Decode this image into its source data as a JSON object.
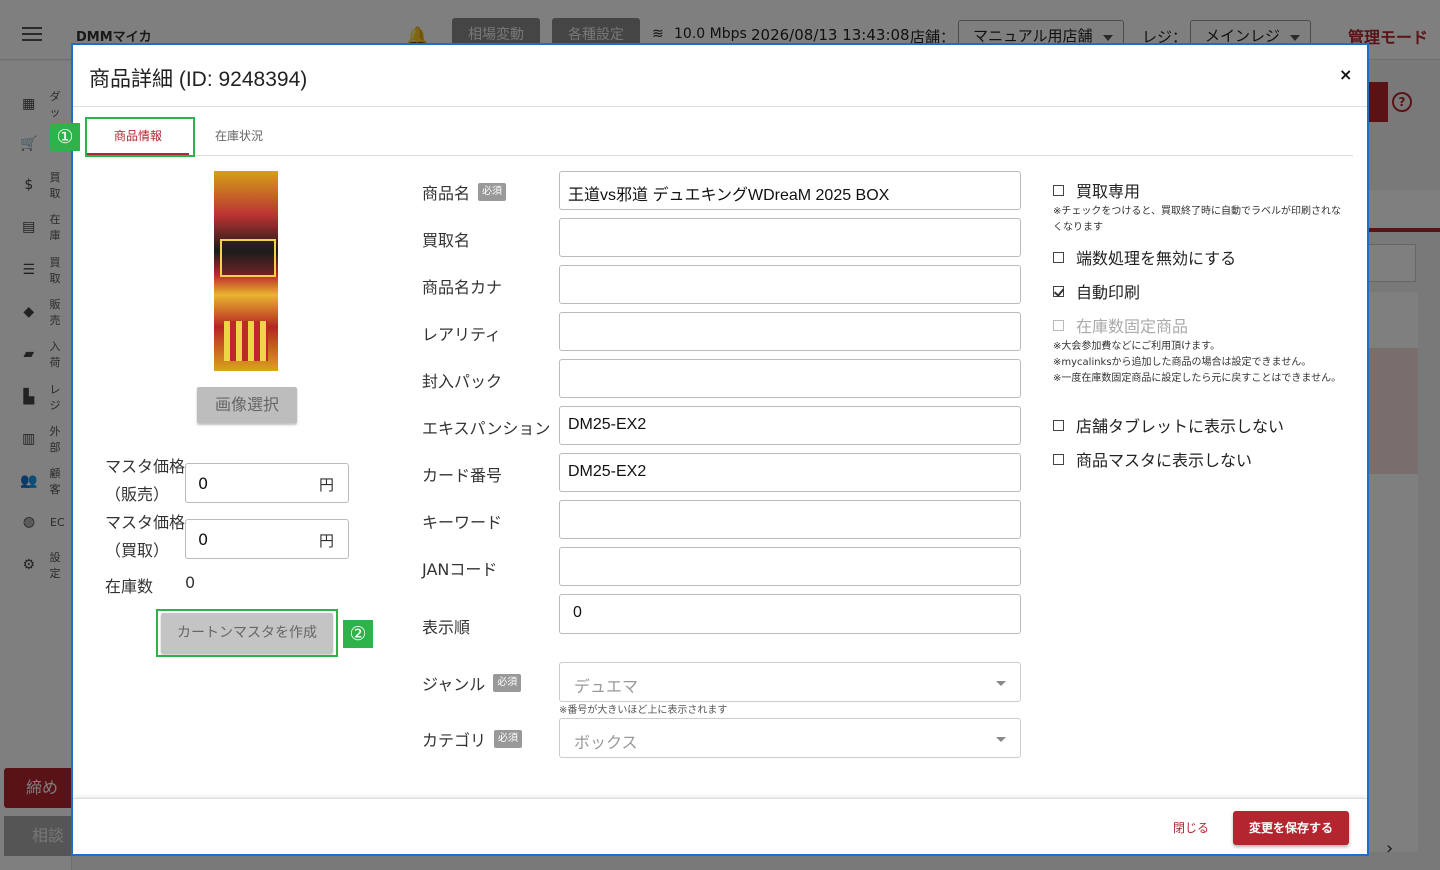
{
  "app": {
    "logo_text": "DMMマイカ",
    "top_buttons": {
      "market": "相場変動",
      "settings": "各種設定"
    },
    "network_speed": "10.0 Mbps",
    "datetime": "2026/08/13 13:43:08",
    "store_label": "店舗：",
    "store_value": "マニュアル用店舗",
    "register_label": "レジ：",
    "register_value": "メインレジ",
    "mode_label": "管理モード",
    "sidebar": {
      "items": [
        {
          "icon": "dashboard-icon",
          "label": "ダッ"
        },
        {
          "icon": "cart-icon",
          "label": ""
        },
        {
          "icon": "dollar-icon",
          "label": "買取"
        },
        {
          "icon": "archive-icon",
          "label": "在庫"
        },
        {
          "icon": "list-icon",
          "label": "買取"
        },
        {
          "icon": "tag-icon",
          "label": "販売"
        },
        {
          "icon": "truck-icon",
          "label": "入荷"
        },
        {
          "icon": "register-icon",
          "label": "レジ"
        },
        {
          "icon": "store-icon",
          "label": "外部"
        },
        {
          "icon": "people-icon",
          "label": "顧客"
        },
        {
          "icon": "globe-icon",
          "label": "EC"
        },
        {
          "icon": "gear-icon",
          "label": "設定"
        }
      ],
      "close_label": "締め",
      "consult_label": "相談"
    }
  },
  "modal": {
    "title": "商品詳細 (ID: 9248394)",
    "close_icon": "×",
    "tabs": [
      {
        "label": "商品情報",
        "active": true
      },
      {
        "label": "在庫状況",
        "active": false
      }
    ],
    "markers": {
      "one": "①",
      "two": "②"
    },
    "image_select_label": "画像選択",
    "prices": {
      "sell_label_line1": "マスタ価格",
      "sell_label_line2": "（販売）",
      "sell_value": "0",
      "buy_label_line1": "マスタ価格",
      "buy_label_line2": "（買取）",
      "buy_value": "0",
      "unit": "円",
      "stock_label": "在庫数",
      "stock_value": "0"
    },
    "carton_button_label": "カートンマスタを作成",
    "required_badge": "必須",
    "fields": {
      "product_name": {
        "label": "商品名",
        "value": "王道vs邪道 デュエキングWDreaM 2025 BOX"
      },
      "buy_name": {
        "label": "買取名",
        "value": ""
      },
      "name_kana": {
        "label": "商品名カナ",
        "value": ""
      },
      "rarity": {
        "label": "レアリティ",
        "value": ""
      },
      "pack": {
        "label": "封入パック",
        "value": ""
      },
      "expansion": {
        "label": "エキスパンション",
        "value": "DM25-EX2"
      },
      "card_number": {
        "label": "カード番号",
        "value": "DM25-EX2"
      },
      "keyword": {
        "label": "キーワード",
        "value": ""
      },
      "jan": {
        "label": "JANコード",
        "value": ""
      },
      "display_order": {
        "label": "表示順",
        "value": "0",
        "hint": "※番号が大きいほど上に表示されます"
      },
      "genre": {
        "label": "ジャンル",
        "value": "デュエマ"
      },
      "category": {
        "label": "カテゴリ",
        "value": "ボックス"
      }
    },
    "options": {
      "buy_only": {
        "label": "買取専用",
        "checked": false,
        "note": "※チェックをつけると、買取終了時に自動でラベルが印刷されなくなります"
      },
      "disable_rounding": {
        "label": "端数処理を無効にする",
        "checked": false
      },
      "auto_print": {
        "label": "自動印刷",
        "checked": true
      },
      "fixed_stock": {
        "label": "在庫数固定商品",
        "checked": false,
        "disabled": true,
        "note_lines": [
          "※大会参加費などにご利用頂けます。",
          "※mycalinksから追加した商品の場合は設定できません。",
          "※一度在庫数固定商品に設定したら元に戻すことはできません。"
        ]
      },
      "hide_tablet": {
        "label": "店舗タブレットに表示しない",
        "checked": false
      },
      "hide_master": {
        "label": "商品マスタに表示しない",
        "checked": false
      }
    },
    "footer": {
      "close_label": "閉じる",
      "save_label": "変更を保存する"
    }
  },
  "colors": {
    "accent": "#b3262f",
    "highlight": "#2db34a",
    "modal_border": "#1f6fc8"
  }
}
